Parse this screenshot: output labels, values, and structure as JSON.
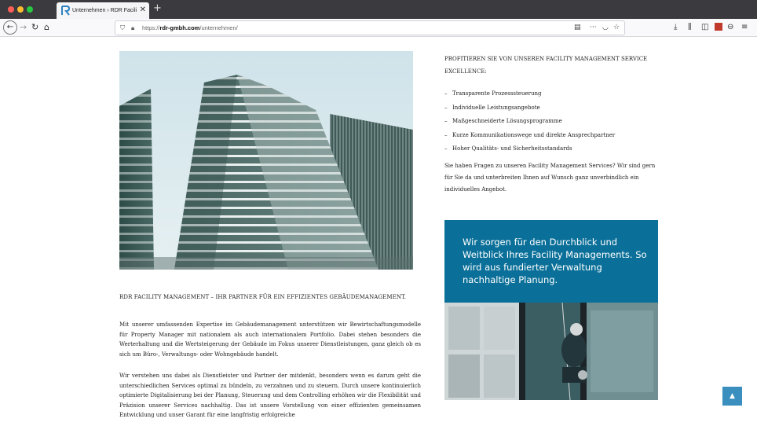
{
  "browser": {
    "tab_title": "Unternehmen › RDR Facility Ma",
    "tab_close": "✕",
    "new_tab": "+",
    "url_prefix": "https://",
    "url_domain": "rdr-gmbh.com",
    "url_path": "/unternehmen/",
    "icons": {
      "back": "←",
      "forward": "→",
      "reload": "↻",
      "home": "⌂",
      "reader": "▤",
      "more": "···",
      "pocket": "◡",
      "star": "☆",
      "download": "⤓",
      "library": "⫼",
      "sidebar": "◫",
      "menu": "≡"
    }
  },
  "left": {
    "hero_image": "building-photo",
    "section_title": "RDR FACILITY MANAGEMENT – IHR PARTNER FÜR EIN EFFIZIENTES GEBÄUDEMANAGEMENT.",
    "paragraph1": "Mit unserer umfassenden Expertise im Gebäudemanagement unterstützen wir Bewirtschaftungs­modelle für Property Manager mit nationalem als auch internationalem Portfolio. Dabei stehen besonders die Werterhaltung und die Wertsteigerung der Gebäude im Fokus unserer Dienst­leistungen, ganz gleich ob es sich um Büro-, Verwaltungs- oder Wohngebäude handelt.",
    "paragraph2": "Wir verstehen uns dabei als Dienstleister und Partner der mitdenkt, besonders wenn es darum geht die unterschiedlichen Services optimal zu bündeln, zu verzahnen und zu steuern. Durch unsere kontinuierlich optimierte Digitalisierung bei der Planung, Steuerung und dem Controlling erhöhen wir die Flexibilität und Präzision unserer Services nachhaltig. Das ist unsere Vorstellung von einer effizienten gemeinsamen Entwicklung und unser Garant für eine langfristig erfolgreiche"
  },
  "right": {
    "heading": "PROFITIEREN SIE VON UNSEREN FACILITY MANAGEMENT SERVICE EXCELLENCE:",
    "list_marker": "–",
    "features": [
      "Transparente Prozesssteuerung",
      "Individuelle Leistungsangebote",
      "Maßgeschneiderte Lösungsprogramme",
      "Kurze Kommunikationswege und direkte Ansprechpartner",
      "Hoher Qualitäts- und Sicherheitsstandards"
    ],
    "contact_text": "Sie haben Fragen zu unseren Facility Management Services? Wir sind gern für Sie da und unterbreiten Ihnen auf Wunsch ganz unverbindlich ein individuelles Angebot.",
    "promo": {
      "text": "Wir sorgen für den Durchblick und Weitblick Ihres Facility Managements. So wird aus fundierter Verwaltung nachhaltige Planung.",
      "color": "#0b7099",
      "image": "window-cleaner-photo"
    }
  },
  "back_to_top": {
    "icon": "▲"
  }
}
